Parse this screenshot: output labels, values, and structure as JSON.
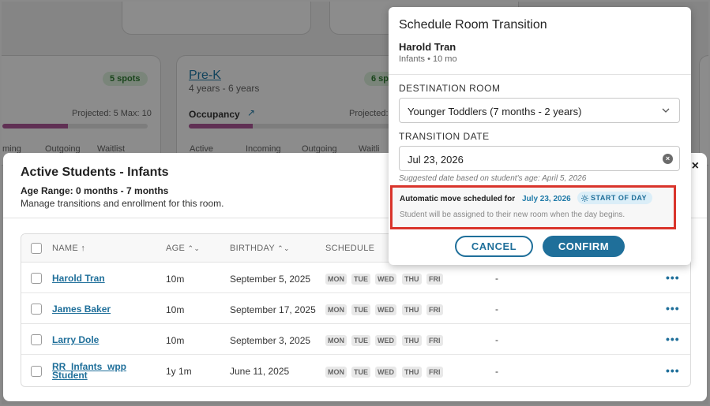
{
  "background": {
    "left_card": {
      "spots": "5 spots",
      "projected": "Projected: 5 Max: 10",
      "occupancy_fill_pct": 45,
      "cols": [
        "ming",
        "Outgoing",
        "Waitlist"
      ]
    },
    "right_card": {
      "title": "Pre-K",
      "subtitle": "4 years - 6 years",
      "spots": "6 sp",
      "projected": "Projected: 4 M",
      "occupancy": "Occupancy",
      "occupancy_fill_pct": 30,
      "cols": [
        "Active",
        "Incoming",
        "Outgoing",
        "Waitli"
      ]
    }
  },
  "students_modal": {
    "title": "Active Students - Infants",
    "age_range": "Age Range: 0 months - 7 months",
    "description": "Manage transitions and enrollment for this room.",
    "close": "×",
    "columns": [
      "NAME",
      "AGE",
      "BIRTHDAY",
      "SCHEDULE"
    ],
    "day_labels": [
      "MON",
      "TUE",
      "WED",
      "THU",
      "FRI"
    ],
    "rows": [
      {
        "name_line1": "Harold Tran",
        "name_line2": "",
        "age": "10m",
        "birthday": "September 5, 2025",
        "extra": "-"
      },
      {
        "name_line1": "James Baker",
        "name_line2": "",
        "age": "10m",
        "birthday": "September 17, 2025",
        "extra": "-"
      },
      {
        "name_line1": "Larry Dole",
        "name_line2": "",
        "age": "10m",
        "birthday": "September 3, 2025",
        "extra": "-"
      },
      {
        "name_line1": "RR_Infants_wpp",
        "name_line2": "Student",
        "age": "1y 1m",
        "birthday": "June 11, 2025",
        "extra": "-"
      }
    ],
    "more": "•••"
  },
  "schedule_modal": {
    "title": "Schedule Room Transition",
    "student_name": "Harold Tran",
    "student_meta": "Infants • 10 mo",
    "destination_label": "DESTINATION ROOM",
    "destination_value": "Younger Toddlers (7 months - 2 years)",
    "date_label": "TRANSITION DATE",
    "date_value": "Jul 23, 2026",
    "clear": "×",
    "hint": "Suggested date based on student's age: April 5, 2026",
    "auto_text": "Automatic move scheduled for",
    "auto_date": "July 23, 2026",
    "pill": "START OF DAY",
    "auto_sub": "Student will be assigned to their new room when the day begins.",
    "cancel": "CANCEL",
    "confirm": "CONFIRM"
  },
  "colors": {
    "accent": "#1f6f9a",
    "highlight_border": "#d9342b",
    "occupancy": "#b0589a"
  }
}
